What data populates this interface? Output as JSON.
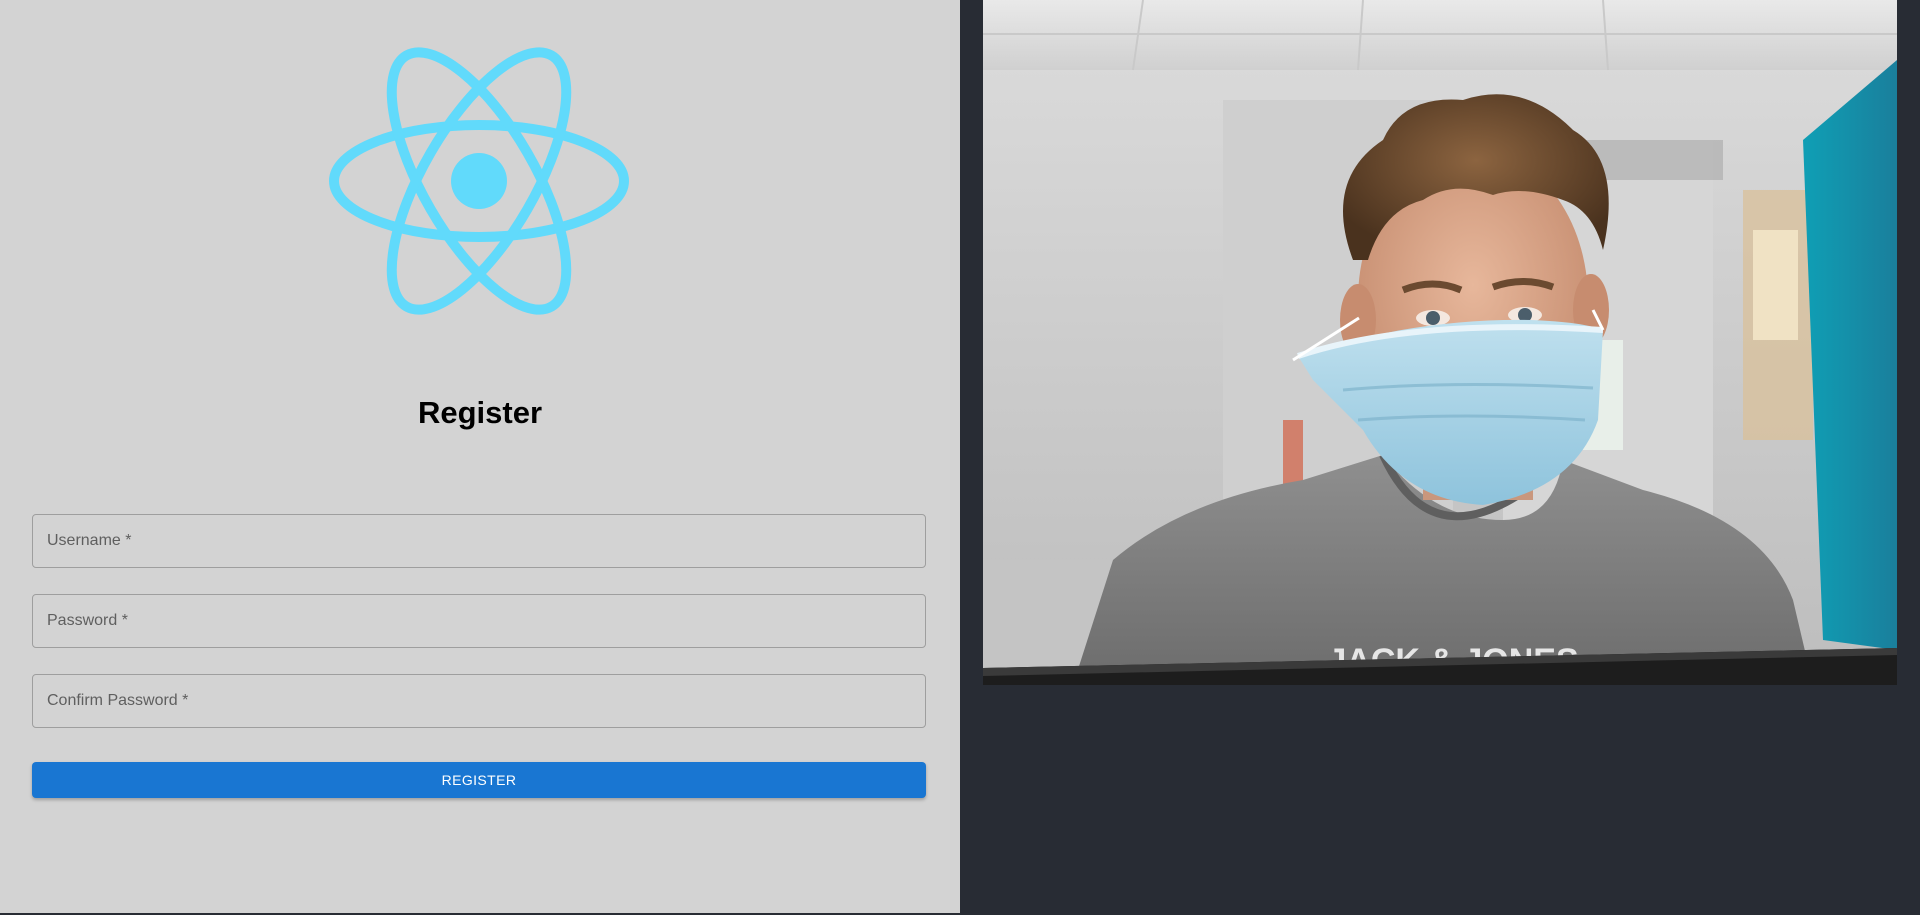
{
  "logo": {
    "icon": "react-atom-icon",
    "color": "#61dafb"
  },
  "form": {
    "title": "Register",
    "fields": {
      "username": {
        "label": "Username *",
        "value": ""
      },
      "password": {
        "label": "Password *",
        "value": ""
      },
      "confirm_password": {
        "label": "Confirm Password *",
        "value": ""
      }
    },
    "submit_label": "REGISTER",
    "button_color": "#1976d2"
  },
  "photo": {
    "subject": "person-wearing-face-mask",
    "shirt_text": "JACK & JONES"
  },
  "colors": {
    "left_background": "#d3d3d3",
    "right_background": "#282c34"
  }
}
